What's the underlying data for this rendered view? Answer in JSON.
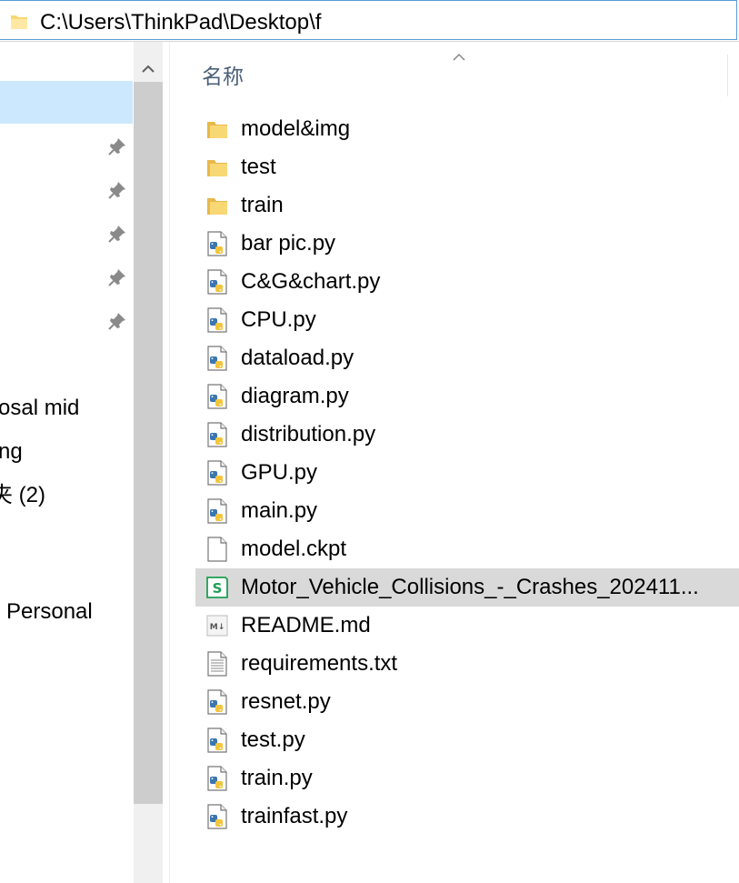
{
  "address_bar": {
    "path": "C:\\Users\\ThinkPad\\Desktop\\f"
  },
  "nav_pane": {
    "items": [
      {
        "label": "osal mid"
      },
      {
        "label": "ng"
      },
      {
        "label": "夹 (2)"
      },
      {
        "label": "Personal"
      }
    ],
    "pinned_count": 5
  },
  "header": {
    "name_column": "名称",
    "sort": "ascending"
  },
  "files": [
    {
      "name": "model&img",
      "type": "folder"
    },
    {
      "name": "test",
      "type": "folder"
    },
    {
      "name": "train",
      "type": "folder"
    },
    {
      "name": "bar pic.py",
      "type": "python"
    },
    {
      "name": "C&G&chart.py",
      "type": "python"
    },
    {
      "name": "CPU.py",
      "type": "python"
    },
    {
      "name": "dataload.py",
      "type": "python"
    },
    {
      "name": "diagram.py",
      "type": "python"
    },
    {
      "name": "distribution.py",
      "type": "python"
    },
    {
      "name": "GPU.py",
      "type": "python"
    },
    {
      "name": "main.py",
      "type": "python"
    },
    {
      "name": "model.ckpt",
      "type": "blank"
    },
    {
      "name": "Motor_Vehicle_Collisions_-_Crashes_202411...",
      "type": "spreadsheet",
      "selected": true
    },
    {
      "name": "README.md",
      "type": "markdown"
    },
    {
      "name": "requirements.txt",
      "type": "text"
    },
    {
      "name": "resnet.py",
      "type": "python"
    },
    {
      "name": "test.py",
      "type": "python"
    },
    {
      "name": "train.py",
      "type": "python"
    },
    {
      "name": "trainfast.py",
      "type": "python"
    }
  ],
  "colors": {
    "selection_nav": "#cce8ff",
    "selection_row": "#d9d9d9",
    "folder": "#f8d775",
    "header_text": "#4c607a",
    "address_border": "#5a9bd5",
    "spreadsheet_green": "#1e9e52"
  }
}
